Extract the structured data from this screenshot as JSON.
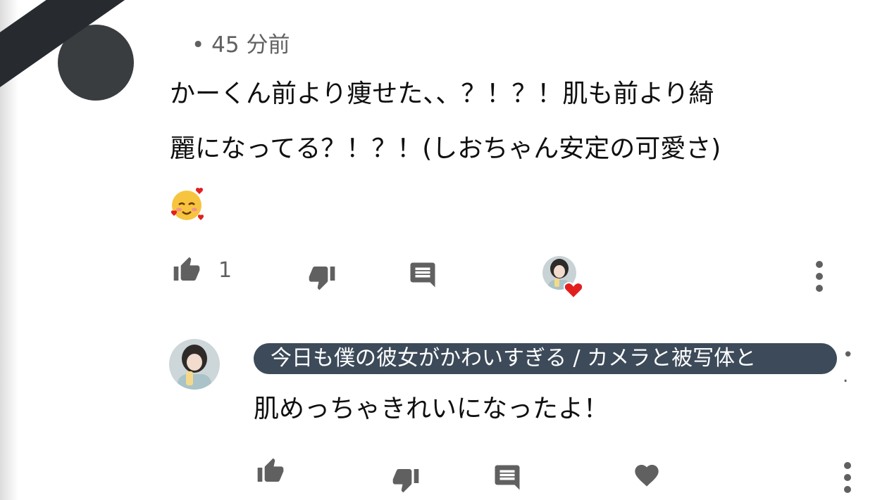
{
  "comment": {
    "time_ago": "45 分前",
    "text_line1": "かーくん前より痩せた、、？！？！肌も前より綺",
    "text_line2": "麗になってる？！？！(しおちゃん安定の可愛さ)",
    "emoji": "smiling-face-with-hearts",
    "like_count": "1"
  },
  "reply": {
    "channel_name": "今日も僕の彼女がかわいすぎる / カメラと被写体と",
    "meta": "• .",
    "text": "肌めっちゃきれいになったよ！"
  },
  "colors": {
    "icon_gray": "#606060",
    "chip_bg": "#3c4a59",
    "heart_red": "#e21f1f",
    "redaction": "#272b30"
  }
}
